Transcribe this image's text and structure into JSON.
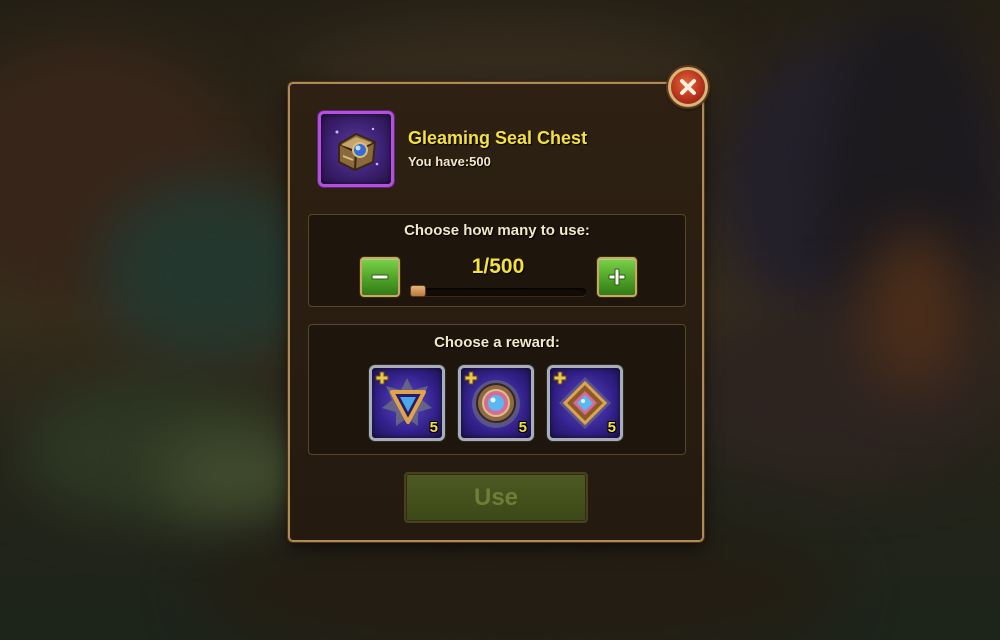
{
  "item": {
    "name": "Gleaming Seal Chest",
    "owned_text": "You have:500",
    "icon": "chest-icon"
  },
  "quantity": {
    "title": "Choose how many to use:",
    "display": "1/500",
    "current": 1,
    "max": 500
  },
  "rewards": {
    "title": "Choose a reward:",
    "items": [
      {
        "icon": "triangle-seal-fragment-icon",
        "count": "5"
      },
      {
        "icon": "round-seal-fragment-icon",
        "count": "5"
      },
      {
        "icon": "square-seal-fragment-icon",
        "count": "5"
      }
    ]
  },
  "actions": {
    "use_label": "Use",
    "use_enabled": false
  },
  "colors": {
    "title_yellow": "#f4e13e",
    "dialog_border": "#b08a55",
    "epic_purple": "#b64fe0",
    "button_green": "#4ea327"
  }
}
